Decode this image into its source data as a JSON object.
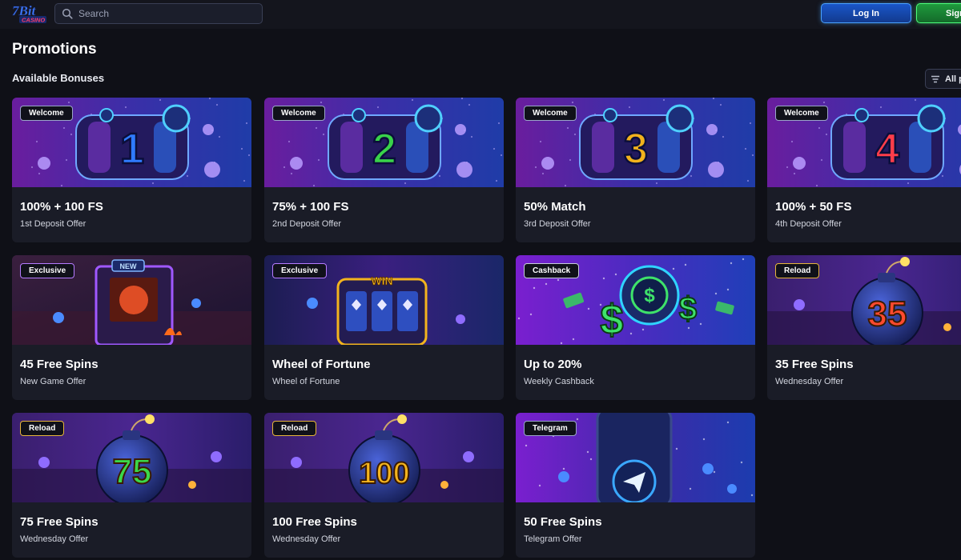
{
  "header": {
    "logo_text": "7Bit CASINO",
    "search": {
      "placeholder": "Search",
      "value": ""
    },
    "login_label": "Log In",
    "signup_label": "Sign Up"
  },
  "page": {
    "title": "Promotions",
    "section_title": "Available Bonuses",
    "filter_label": "All promotions"
  },
  "colors": {
    "background": "#0f1017",
    "card": "#1a1c27",
    "login_border": "#4aa3ff",
    "signup_border": "#4dff7c"
  },
  "cards": [
    {
      "badge": "Welcome",
      "badge_color": "#9aa4c8",
      "title": "100% + 100 FS",
      "subtitle": "1st Deposit Offer",
      "art": "slot",
      "art_label": "1",
      "art_color": "#2f7bff"
    },
    {
      "badge": "Welcome",
      "badge_color": "#9aa4c8",
      "title": "75% + 100 FS",
      "subtitle": "2nd Deposit Offer",
      "art": "slot",
      "art_label": "2",
      "art_color": "#39d24a"
    },
    {
      "badge": "Welcome",
      "badge_color": "#9aa4c8",
      "title": "50% Match",
      "subtitle": "3rd Deposit Offer",
      "art": "slot",
      "art_label": "3",
      "art_color": "#f2b21c"
    },
    {
      "badge": "Welcome",
      "badge_color": "#9aa4c8",
      "title": "100% + 50 FS",
      "subtitle": "4th Deposit Offer",
      "art": "slot",
      "art_label": "4",
      "art_color": "#ff3d4a"
    },
    {
      "badge": "Exclusive",
      "badge_color": "#b57bff",
      "title": "45 Free Spins",
      "subtitle": "New Game Offer",
      "art": "machine",
      "art_label": "NEW",
      "art_color": "#ff5a2a"
    },
    {
      "badge": "Exclusive",
      "badge_color": "#b57bff",
      "title": "Wheel of Fortune",
      "subtitle": "Wheel of Fortune",
      "art": "win",
      "art_label": "WIN",
      "art_color": "#f6c421"
    },
    {
      "badge": "Cashback",
      "badge_color": "#c7ccd8",
      "title": "Up to 20%",
      "subtitle": "Weekly Cashback",
      "art": "cash",
      "art_label": "$",
      "art_color": "#3ee26a"
    },
    {
      "badge": "Reload",
      "badge_color": "#e6b53a",
      "title": "35 Free Spins",
      "subtitle": "Wednesday Offer",
      "art": "bomb",
      "art_label": "35",
      "art_color": "#ff4a2e"
    },
    {
      "badge": "Reload",
      "badge_color": "#e6b53a",
      "title": "75 Free Spins",
      "subtitle": "Wednesday Offer",
      "art": "bomb",
      "art_label": "75",
      "art_color": "#3bd84a"
    },
    {
      "badge": "Reload",
      "badge_color": "#e6b53a",
      "title": "100 Free Spins",
      "subtitle": "Wednesday Offer",
      "art": "bomb",
      "art_label": "100",
      "art_color": "#f4b41e"
    },
    {
      "badge": "Telegram",
      "badge_color": "#9aa4c8",
      "title": "50 Free Spins",
      "subtitle": "Telegram Offer",
      "art": "telegram",
      "art_label": "",
      "art_color": "#3aa8ff"
    }
  ]
}
